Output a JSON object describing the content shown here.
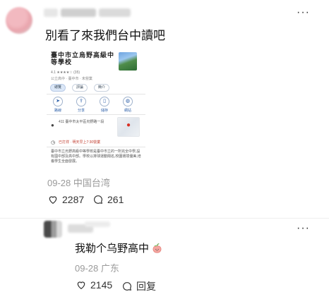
{
  "comment": {
    "text": "別看了來我們台中讀吧",
    "date": "09-28",
    "location": "中国台湾",
    "likes": "2287",
    "replies": "261",
    "more_icon": "more-horizontal-icon"
  },
  "screenshot": {
    "title": "臺中市立烏野高級中等學校",
    "rating_text": "4.1 ★★★★☆ (35)",
    "subtitle": "公立高中 · 臺中市 · 未營業",
    "chips": [
      "總覽",
      "評論",
      "簡介"
    ],
    "actions": [
      "路線",
      "分享",
      "儲存",
      "網站"
    ],
    "address": "411 臺中市太平區烏野路一段",
    "hours": "已打烊 · 明天早上7:30營業",
    "description": "臺中市立烏野高級中等學校是臺中市立的一所完全中學,設有國中部及高中部。學校以排球運動聞名,校園環境優美,培養學生全面發展。"
  },
  "reply": {
    "text": "我勒个乌野高中",
    "emoji": "peach-emoji",
    "date": "09-28",
    "location": "广东",
    "likes": "2145",
    "reply_label": "回复",
    "more_icon": "more-horizontal-icon"
  },
  "colors": {
    "text": "#111111",
    "meta": "#9a9a9a",
    "divider": "#eeeeee"
  }
}
